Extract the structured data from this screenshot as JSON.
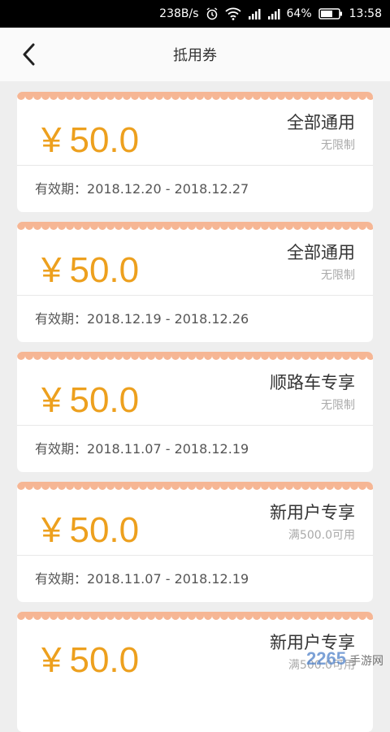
{
  "status_bar": {
    "speed": "238B/s",
    "battery": "64%",
    "time": "13:58",
    "icons": [
      "alarm-icon",
      "wifi-icon",
      "signal-icon",
      "signal-icon",
      "battery-icon"
    ]
  },
  "header": {
    "title": "抵用券",
    "back_icon": "chevron-left-icon"
  },
  "validity_label": "有效期：",
  "coupons": [
    {
      "currency": "¥",
      "amount": "50.0",
      "scope": "全部通用",
      "condition": "无限制",
      "validity": "2018.12.20 - 2018.12.27"
    },
    {
      "currency": "¥",
      "amount": "50.0",
      "scope": "全部通用",
      "condition": "无限制",
      "validity": "2018.12.19 - 2018.12.26"
    },
    {
      "currency": "¥",
      "amount": "50.0",
      "scope": "顺路车专享",
      "condition": "无限制",
      "validity": "2018.11.07 - 2018.12.19"
    },
    {
      "currency": "¥",
      "amount": "50.0",
      "scope": "新用户专享",
      "condition": "满500.0可用",
      "validity": "2018.11.07 - 2018.12.19"
    },
    {
      "currency": "¥",
      "amount": "50.0",
      "scope": "新用户专享",
      "condition": "满500.0可用",
      "validity": ""
    }
  ],
  "watermark": {
    "text": "2265",
    "sub": "手游网"
  },
  "colors": {
    "accent": "#eda01e",
    "scallop": "#f6b694",
    "background": "#eeeeee"
  }
}
